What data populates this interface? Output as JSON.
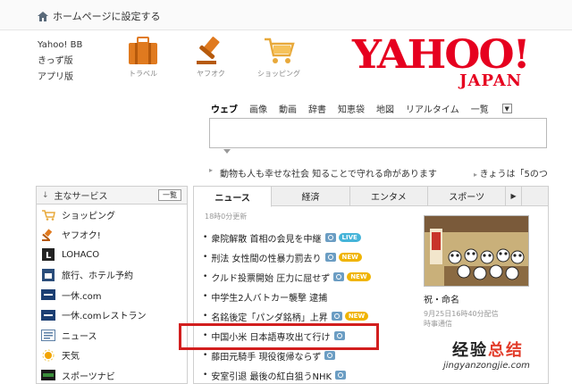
{
  "topbar": {
    "home_text": "ホームページに設定する"
  },
  "left_links": [
    "Yahoo! BB",
    "きっず版",
    "アプリ版"
  ],
  "services": [
    {
      "label": "トラベル",
      "icon": "suitcase-icon"
    },
    {
      "label": "ヤフオク",
      "icon": "auction-hammer-icon"
    },
    {
      "label": "ショッピング",
      "icon": "shopping-cart-icon"
    }
  ],
  "logo": {
    "main": "YAHOO!",
    "sub": "JAPAN"
  },
  "search": {
    "tabs": [
      "ウェブ",
      "画像",
      "動画",
      "辞書",
      "知恵袋",
      "地図",
      "リアルタイム"
    ],
    "more": "一覧",
    "query": ""
  },
  "ticker": [
    "動物も人も幸せな社会 知ることで守れる命があります",
    "きょうは「5のつ"
  ],
  "sidebar": {
    "title": "主なサービス",
    "list_button": "一覧",
    "items": [
      "ショッピング",
      "ヤフオク!",
      "LOHACO",
      "旅行、ホテル予約",
      "一休.com",
      "一休.comレストラン",
      "ニュース",
      "天気",
      "スポーツナビ"
    ]
  },
  "news": {
    "tabs": [
      "ニュース",
      "経済",
      "エンタメ",
      "スポーツ"
    ],
    "timestamp": "18時0分更新",
    "headlines": [
      {
        "text": "衆院解散 首相の会見を中継",
        "cam": true,
        "badge": "LIVE"
      },
      {
        "text": "刑法 女性間の性暴力罰去り",
        "cam": true,
        "badge": "NEW"
      },
      {
        "text": "クルド投票開始 圧力に屈せず",
        "cam": true,
        "badge": "NEW"
      },
      {
        "text": "中学生2人バトカー襲撃 逮捕",
        "cam": false,
        "badge": ""
      },
      {
        "text": "名銘後定「パンダ銘柄」上昇",
        "cam": true,
        "badge": "NEW"
      },
      {
        "text": "中国小米 日本語専攻出て行け",
        "cam": true,
        "badge": ""
      },
      {
        "text": "藤田元騎手 現役復帰ならず",
        "cam": true,
        "badge": ""
      },
      {
        "text": "安室引退 最後の紅白狙うNHK",
        "cam": true,
        "badge": ""
      }
    ],
    "feature": {
      "caption": "祝・命名",
      "meta1": "9月25日16時40分配信",
      "meta2": "時事通信"
    }
  },
  "watermark": {
    "text_a": "经验",
    "text_b": "总结",
    "url": "jingyanzongjie.com"
  },
  "colors": {
    "brand_red": "#e6001f",
    "highlight": "#d21e1e",
    "live": "#45b4d9",
    "new": "#f0b400"
  }
}
